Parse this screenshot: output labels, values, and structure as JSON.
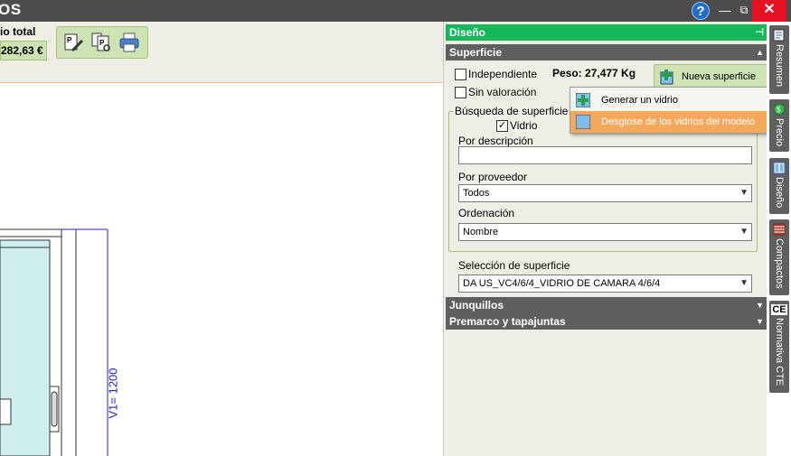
{
  "window": {
    "title": "os",
    "help_label": "?",
    "minimize_label": "—",
    "maximize_label": "⧉",
    "close_label": "✕"
  },
  "toolbar": {
    "price_label": "io total",
    "price_value": "282,63 €"
  },
  "drawing": {
    "dimension_label": "V1= 1200"
  },
  "panel": {
    "header_diseno": "Diseño",
    "header_superficie": "Superficie",
    "chk_independiente": "Independiente",
    "chk_sin_valoracion": "Sin valoración",
    "peso": "Peso: 27,477 Kg",
    "nueva_superficie": "Nueva superficie",
    "busqueda_legend": "Búsqueda de superficie",
    "chk_vidrio": "Vidrio",
    "por_descripcion_label": "Por descripción",
    "por_descripcion_value": "",
    "por_proveedor_label": "Por proveedor",
    "por_proveedor_value": "Todos",
    "ordenacion_label": "Ordenación",
    "ordenacion_value": "Nombre",
    "seleccion_label": "Selección de superficie",
    "seleccion_value": "DA US_VC4/6/4_VIDRIO DE CAMARA 4/6/4",
    "header_junquillos": "Junquillos",
    "header_premarco": "Premarco y tapajuntas"
  },
  "menu": {
    "item1": "Generar un vidrio",
    "item2": "Desglose de los vidrios del modelo"
  },
  "sidetabs": {
    "resumen": "Resumen",
    "precio": "Precio",
    "diseno": "Diseño",
    "compactos": "Compactos",
    "normativa": "Normativa CTE",
    "ce_mark": "CE"
  },
  "colors": {
    "accent_green": "#14b85b",
    "header_gray": "#5f5f5f",
    "menu_highlight": "#f6a85a",
    "close_red": "#e81123"
  }
}
